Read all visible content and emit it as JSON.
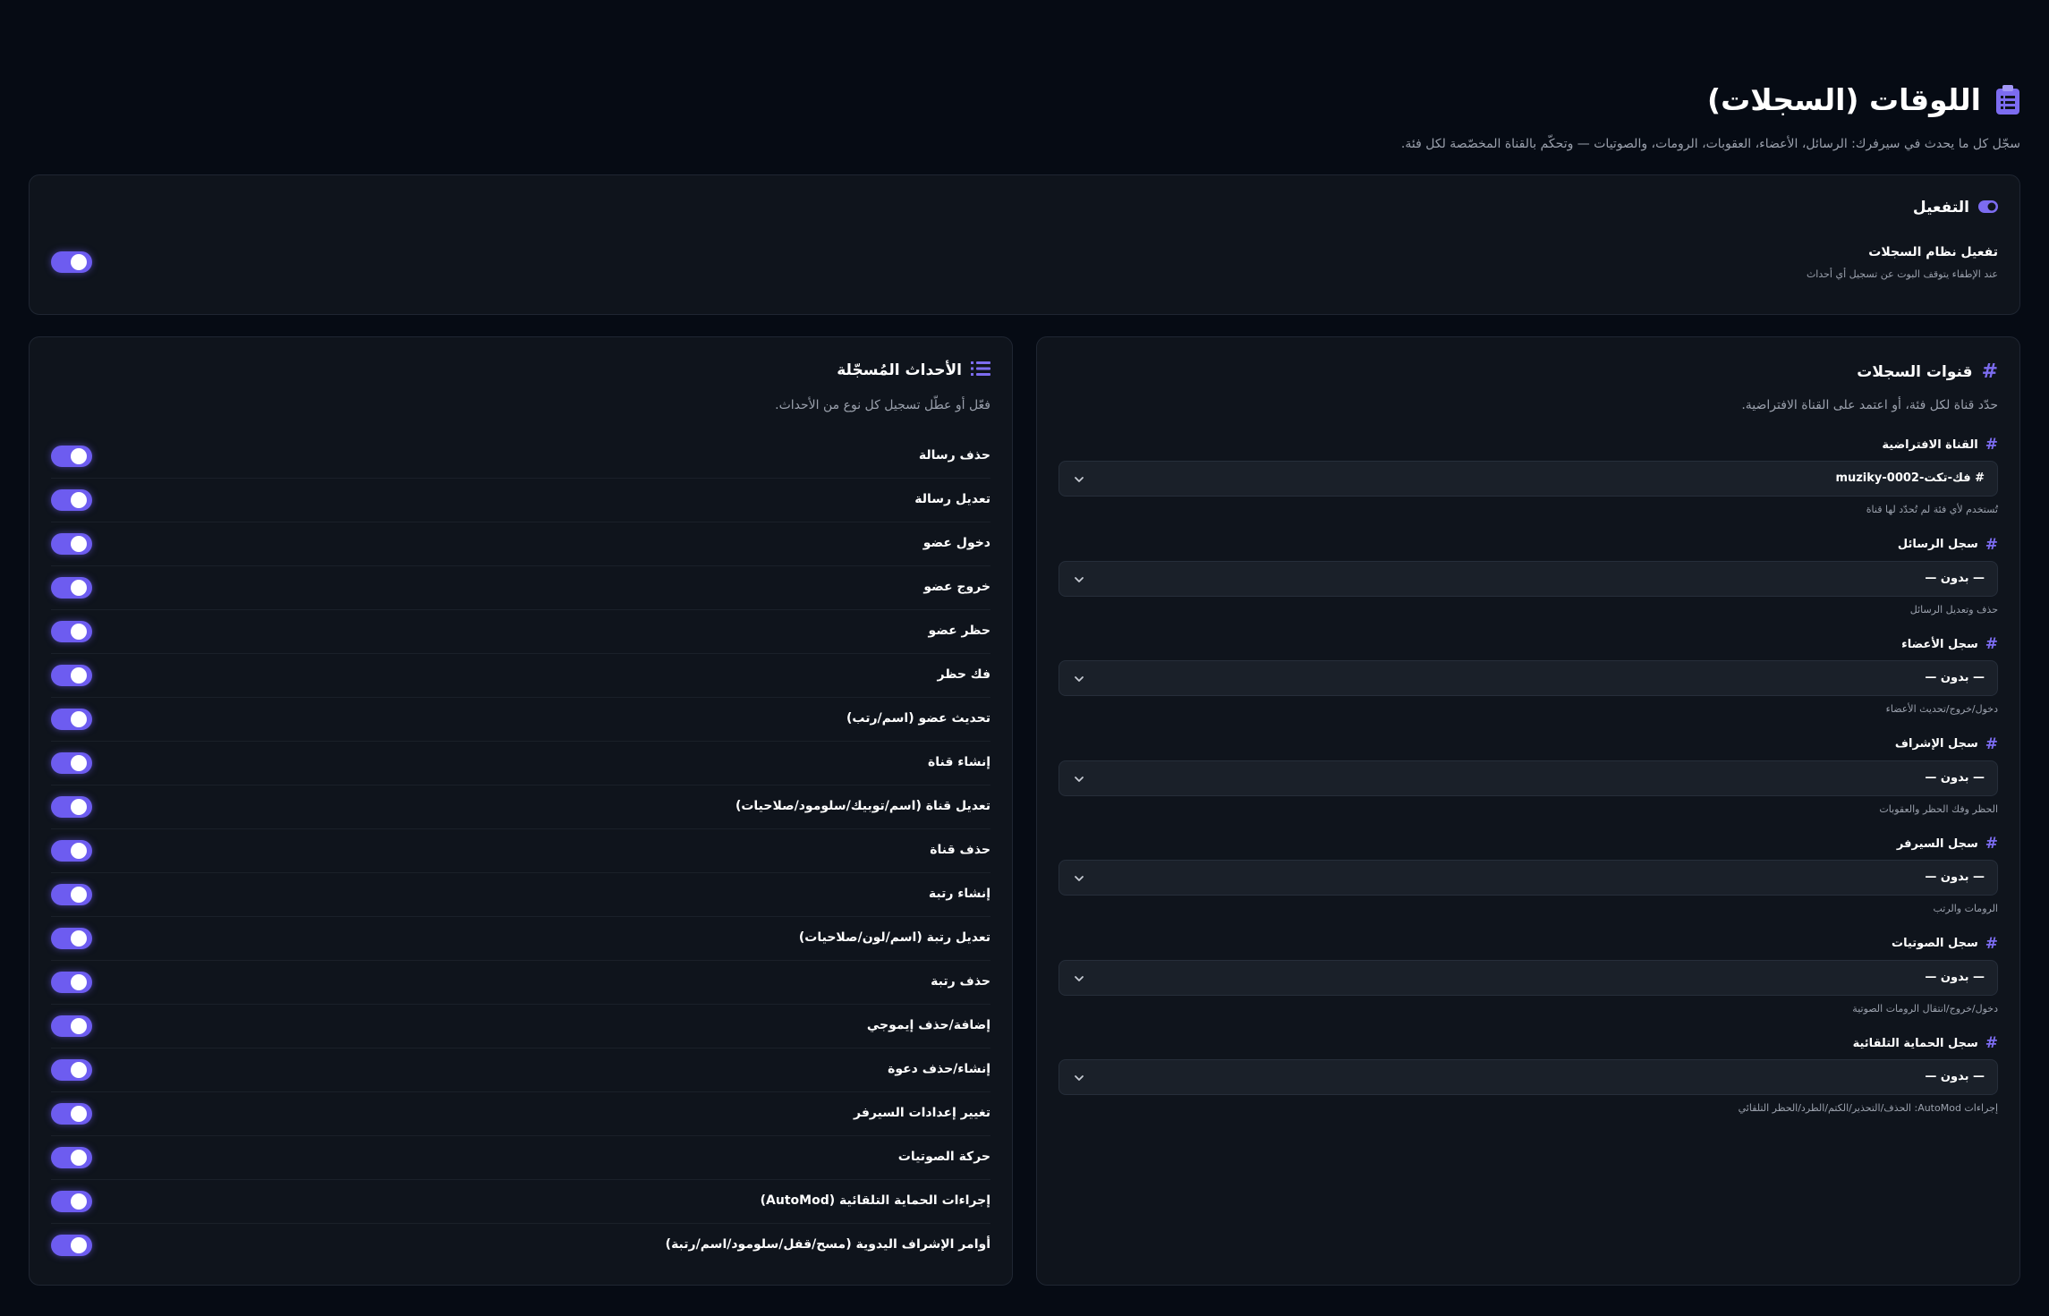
{
  "header": {
    "title": "اللوقات (السجلات)",
    "subtitle": "سجّل كل ما يحدث في سيرفرك: الرسائل، الأعضاء، العقوبات، الرومات، والصوتيات — وتحكّم بالقناة المخصّصة لكل فئة."
  },
  "activation": {
    "title": "التفعيل",
    "label": "تفعيل نظام السجلات",
    "help": "عند الإطفاء يتوقف البوت عن تسجيل أي أحداث",
    "enabled": true
  },
  "channels": {
    "title": "قنوات السجلات",
    "description": "حدّد قناة لكل فئة، أو اعتمد على القناة الافتراضية.",
    "items": [
      {
        "label": "القناة الافتراضية",
        "value": "# فك-تكت-muziky-0002",
        "help": "تُستخدم لأي فئة لم تُحدّد لها قناة"
      },
      {
        "label": "سجل الرسائل",
        "value": "— بدون —",
        "help": "حذف وتعديل الرسائل"
      },
      {
        "label": "سجل الأعضاء",
        "value": "— بدون —",
        "help": "دخول/خروج/تحديث الأعضاء"
      },
      {
        "label": "سجل الإشراف",
        "value": "— بدون —",
        "help": "الحظر وفك الحظر والعقوبات"
      },
      {
        "label": "سجل السيرفر",
        "value": "— بدون —",
        "help": "الرومات والرتب"
      },
      {
        "label": "سجل الصوتيات",
        "value": "— بدون —",
        "help": "دخول/خروج/انتقال الرومات الصوتية"
      },
      {
        "label": "سجل الحماية التلقائية",
        "value": "— بدون —",
        "help": "إجراءات AutoMod: الحذف/التحذير/الكتم/الطرد/الحظر التلقائي"
      }
    ]
  },
  "events": {
    "title": "الأحداث المُسجّلة",
    "description": "فعّل أو عطّل تسجيل كل نوع من الأحداث.",
    "items": [
      {
        "label": "حذف رسالة",
        "enabled": true
      },
      {
        "label": "تعديل رسالة",
        "enabled": true
      },
      {
        "label": "دخول عضو",
        "enabled": true
      },
      {
        "label": "خروج عضو",
        "enabled": true
      },
      {
        "label": "حظر عضو",
        "enabled": true
      },
      {
        "label": "فك حظر",
        "enabled": true
      },
      {
        "label": "تحديث عضو (اسم/رتب)",
        "enabled": true
      },
      {
        "label": "إنشاء قناة",
        "enabled": true
      },
      {
        "label": "تعديل قناة (اسم/توبيك/سلومود/صلاحيات)",
        "enabled": true
      },
      {
        "label": "حذف قناة",
        "enabled": true
      },
      {
        "label": "إنشاء رتبة",
        "enabled": true
      },
      {
        "label": "تعديل رتبة (اسم/لون/صلاحيات)",
        "enabled": true
      },
      {
        "label": "حذف رتبة",
        "enabled": true
      },
      {
        "label": "إضافة/حذف إيموجي",
        "enabled": true
      },
      {
        "label": "إنشاء/حذف دعوة",
        "enabled": true
      },
      {
        "label": "تغيير إعدادات السيرفر",
        "enabled": true
      },
      {
        "label": "حركة الصوتيات",
        "enabled": true
      },
      {
        "label": "إجراءات الحماية التلقائية (AutoMod)",
        "enabled": true
      },
      {
        "label": "أوامر الإشراف اليدوية (مسح/قفل/سلومود/اسم/رتبة)",
        "enabled": true
      }
    ]
  },
  "colors": {
    "accent": "#6d5cf0",
    "background": "#060b14",
    "card": "#0f141c"
  }
}
